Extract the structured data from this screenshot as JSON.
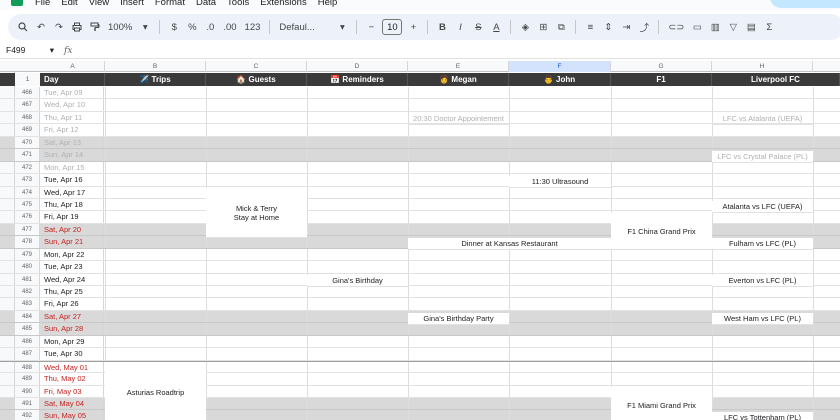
{
  "menu": [
    "File",
    "Edit",
    "View",
    "Insert",
    "Format",
    "Data",
    "Tools",
    "Extensions",
    "Help"
  ],
  "toolbar": {
    "zoom": "100%",
    "currency": "$",
    "percent": "%",
    "dec_decrease": ".0",
    "dec_increase": ".00",
    "number_format": "123",
    "font": "Defaul...",
    "font_size": "10",
    "minus": "−",
    "plus": "+",
    "bold": "B",
    "italic": "I",
    "strike": "S",
    "text_color": "A",
    "sigma": "Σ"
  },
  "formula_bar": {
    "cell_ref": "F499",
    "fx": "fx",
    "value": ""
  },
  "columns": [
    "A",
    "B",
    "C",
    "D",
    "E",
    "F",
    "G",
    "H"
  ],
  "header": {
    "row_number": "1",
    "day": "Day",
    "trips": "✈️ Trips",
    "guests": "🏠 Guests",
    "reminders": "📅 Reminders",
    "megan": "👩 Megan",
    "john": "👨 John",
    "f1": "F1",
    "liverpool": "Liverpool FC"
  },
  "rows": [
    {
      "num": "466",
      "day": "Tue, Apr 09",
      "weekend": false,
      "past": true
    },
    {
      "num": "467",
      "day": "Wed, Apr 10",
      "weekend": false,
      "past": true
    },
    {
      "num": "468",
      "day": "Thu, Apr 11",
      "weekend": false,
      "past": true
    },
    {
      "num": "469",
      "day": "Fri, Apr 12",
      "weekend": false,
      "past": true
    },
    {
      "num": "470",
      "day": "Sat, Apr 13",
      "weekend": true,
      "past": true
    },
    {
      "num": "471",
      "day": "Sun, Apr 14",
      "weekend": true,
      "past": true
    },
    {
      "num": "472",
      "day": "Mon, Apr 15",
      "weekend": false,
      "past": true
    },
    {
      "num": "473",
      "day": "Tue, Apr 16",
      "weekend": false,
      "past": false
    },
    {
      "num": "474",
      "day": "Wed, Apr 17",
      "weekend": false,
      "past": false
    },
    {
      "num": "475",
      "day": "Thu, Apr 18",
      "weekend": false,
      "past": false
    },
    {
      "num": "476",
      "day": "Fri, Apr 19",
      "weekend": false,
      "past": false
    },
    {
      "num": "477",
      "day": "Sat, Apr 20",
      "weekend": true,
      "past": false
    },
    {
      "num": "478",
      "day": "Sun, Apr 21",
      "weekend": true,
      "past": false
    },
    {
      "num": "479",
      "day": "Mon, Apr 22",
      "weekend": false,
      "past": false
    },
    {
      "num": "480",
      "day": "Tue, Apr 23",
      "weekend": false,
      "past": false
    },
    {
      "num": "481",
      "day": "Wed, Apr 24",
      "weekend": false,
      "past": false
    },
    {
      "num": "482",
      "day": "Thu, Apr 25",
      "weekend": false,
      "past": false
    },
    {
      "num": "483",
      "day": "Fri, Apr 26",
      "weekend": false,
      "past": false
    },
    {
      "num": "484",
      "day": "Sat, Apr 27",
      "weekend": true,
      "past": false
    },
    {
      "num": "485",
      "day": "Sun, Apr 28",
      "weekend": true,
      "past": false
    },
    {
      "num": "486",
      "day": "Mon, Apr 29",
      "weekend": false,
      "past": false
    },
    {
      "num": "487",
      "day": "Tue, Apr 30",
      "weekend": false,
      "past": false
    },
    {
      "num": "488",
      "day": "Wed, May 01",
      "weekend": false,
      "past": false,
      "red": true
    },
    {
      "num": "489",
      "day": "Thu, May 02",
      "weekend": false,
      "past": false,
      "red": true
    },
    {
      "num": "490",
      "day": "Fri, May 03",
      "weekend": false,
      "past": false,
      "red": true
    },
    {
      "num": "491",
      "day": "Sat, May 04",
      "weekend": true,
      "past": false
    },
    {
      "num": "492",
      "day": "Sun, May 05",
      "weekend": true,
      "past": false
    }
  ],
  "events": {
    "megan_doctor": "20:30 Doctor Appointement",
    "lfc_atalanta_uefa": "LFC vs Atalanta (UEFA)",
    "lfc_crystal_palace": "LFC vs Crystal Palace (PL)",
    "john_ultrasound": "11:30 Ultrasound",
    "guests_mick_terry": "Mick & Terry Stay at Home",
    "atalanta_lfc_uefa": "Atalanta vs LFC (UEFA)",
    "f1_china": "F1 China Grand Prix",
    "dinner_kansas": "Dinner at Kansas Restaurant",
    "fulham_lfc": "Fulham vs LFC (PL)",
    "reminder_gina_birthday": "Gina's Birthday",
    "everton_lfc": "Everton vs LFC (PL)",
    "megan_gina_party": "Gina's Birthday Party",
    "west_ham_lfc": "West Ham vs LFC (PL)",
    "trip_asturias": "Asturias Roadtrip",
    "f1_miami": "F1 Miami Grand Prix",
    "lfc_tottenham": "LFC vs Tottenham (PL)"
  },
  "colors": {
    "header_bg": "#3a3a3a",
    "weekend_bg": "#d9d9d9",
    "weekend_text": "#c5221f",
    "toolbar_bg": "#edf2fa"
  }
}
